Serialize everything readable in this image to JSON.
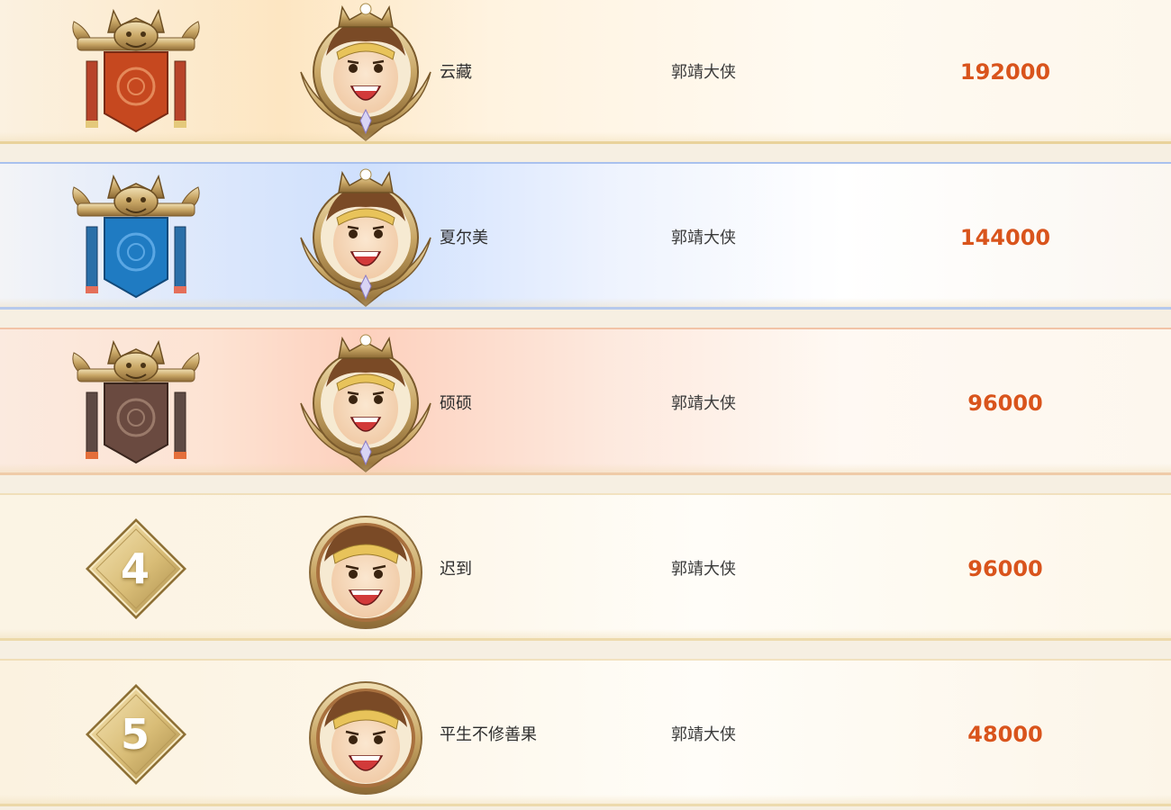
{
  "leaderboard": {
    "rows": [
      {
        "rank": "1",
        "rank_icon": "red-dragon-banner-icon",
        "banner_color": "#c6481f",
        "name": "云藏",
        "title": "郭靖大侠",
        "score": "192000",
        "avatar": "gold-crowned-hero-avatar"
      },
      {
        "rank": "2",
        "rank_icon": "blue-dragon-banner-icon",
        "banner_color": "#1f7bc2",
        "name": "夏尔美",
        "title": "郭靖大侠",
        "score": "144000",
        "avatar": "gold-crowned-hero-avatar"
      },
      {
        "rank": "3",
        "rank_icon": "brown-dragon-banner-icon",
        "banner_color": "#6a4a40",
        "name": "硕硕",
        "title": "郭靖大侠",
        "score": "96000",
        "avatar": "gold-crowned-hero-avatar"
      },
      {
        "rank": "4",
        "rank_icon": "gold-diamond-rank-icon",
        "name": "迟到",
        "title": "郭靖大侠",
        "score": "96000",
        "avatar": "round-hero-avatar"
      },
      {
        "rank": "5",
        "rank_icon": "gold-diamond-rank-icon",
        "name": "平生不修善果",
        "title": "郭靖大侠",
        "score": "48000",
        "avatar": "round-hero-avatar"
      }
    ]
  },
  "colors": {
    "score": "#d9541c",
    "gold": "#caa866",
    "rank2_accent": "#cfe0fd",
    "rank3_accent": "#fdd0bd"
  }
}
